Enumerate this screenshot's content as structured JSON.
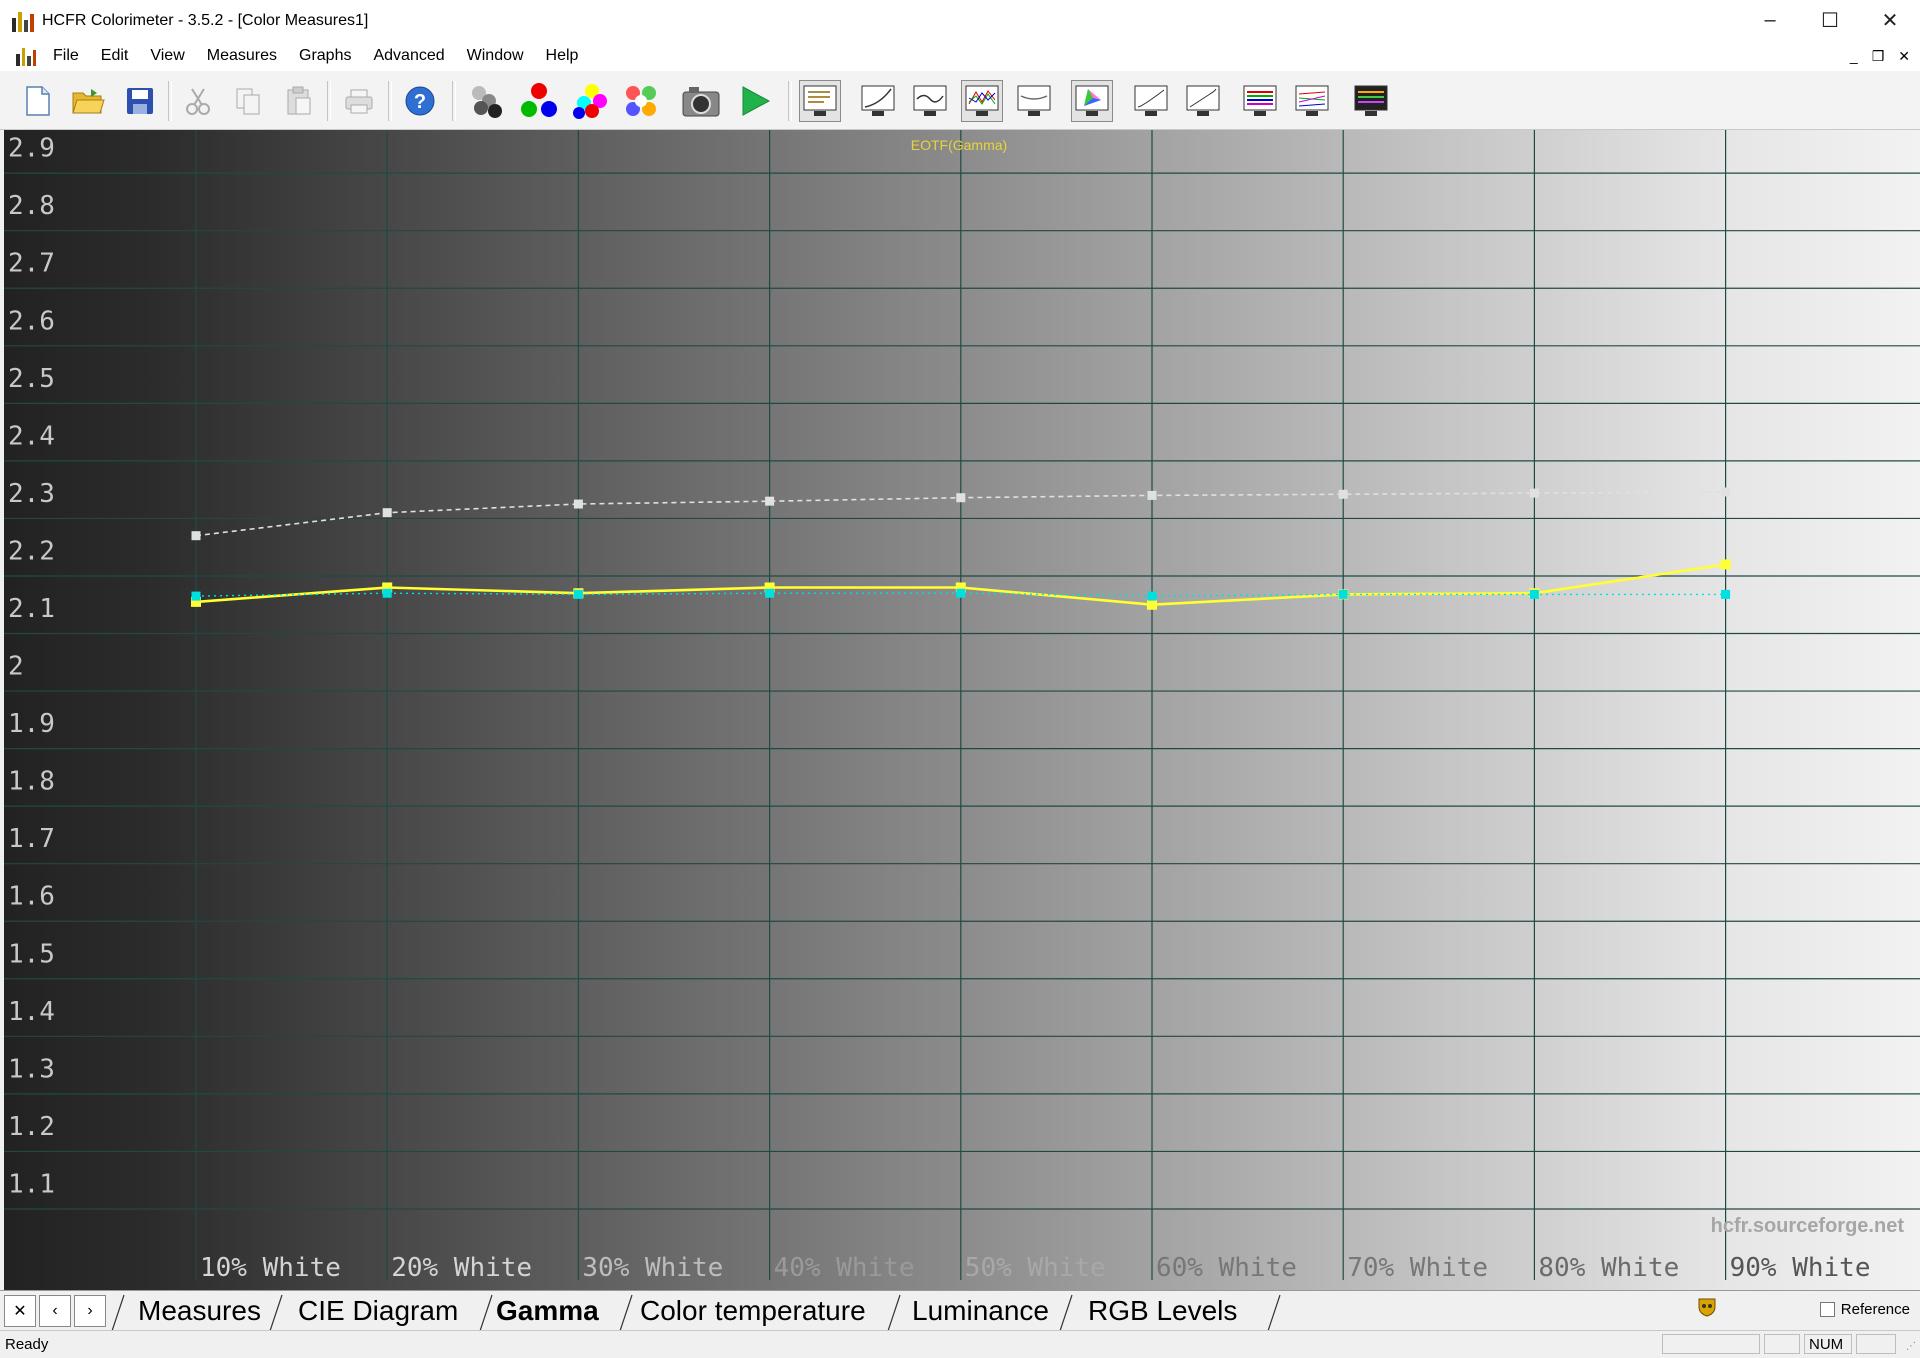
{
  "window": {
    "title": "HCFR Colorimeter - 3.5.2 - [Color Measures1]",
    "controls": [
      "–",
      "☐",
      "✕"
    ]
  },
  "menu": {
    "items": [
      "File",
      "Edit",
      "View",
      "Measures",
      "Graphs",
      "Advanced",
      "Window",
      "Help"
    ],
    "mdi_controls": [
      "_",
      "❒",
      "✕"
    ]
  },
  "toolbar": {
    "buttons": [
      "new-file-icon",
      "open-folder-icon",
      "save-icon",
      "cut-icon",
      "copy-icon",
      "paste-icon",
      "print-icon",
      "help-icon",
      "grayscale-measure-icon",
      "primaries-measure-icon",
      "secondaries-measure-icon",
      "saturation-measure-icon",
      "camera-icon",
      "play-icon",
      "measures-view-icon",
      "gamma-view-icon",
      "luminance-view-icon",
      "rgb-levels-view-icon",
      "color-temp-view-icon",
      "cie-view-icon",
      "near-black-view-icon",
      "near-white-view-icon",
      "saturation-view-icon",
      "saturation-shift-view-icon",
      "colorchecker-view-icon"
    ]
  },
  "chart_data": {
    "type": "line",
    "title": "EOTF(Gamma)",
    "watermark": "hcfr.sourceforge.net",
    "categories": [
      "10% White",
      "20% White",
      "30% White",
      "40% White",
      "50% White",
      "60% White",
      "70% White",
      "80% White",
      "90% White"
    ],
    "y_ticks": [
      "2.9",
      "2.8",
      "2.7",
      "2.6",
      "2.5",
      "2.4",
      "2.3",
      "2.2",
      "2.1",
      "2",
      "1.9",
      "1.8",
      "1.7",
      "1.6",
      "1.5",
      "1.4",
      "1.3",
      "1.2",
      "1.1"
    ],
    "ylim": [
      1.02,
      2.975
    ],
    "grid": true,
    "series": [
      {
        "color": "#e0e0e0",
        "style": "dashed",
        "values": [
          2.27,
          2.31,
          2.325,
          2.33,
          2.336,
          2.34,
          2.342,
          2.344,
          2.346
        ]
      },
      {
        "color": "#ffff33",
        "style": "solid",
        "values": [
          2.155,
          2.18,
          2.17,
          2.18,
          2.18,
          2.15,
          2.168,
          2.17,
          2.22
        ]
      },
      {
        "color": "#00e0e0",
        "style": "dotted",
        "values": [
          2.165,
          2.17,
          2.168,
          2.17,
          2.17,
          2.165,
          2.168,
          2.168,
          2.168
        ]
      }
    ]
  },
  "tabs": {
    "nav": [
      "✕",
      "‹",
      "›"
    ],
    "items": [
      "Measures",
      "CIE Diagram",
      "Gamma",
      "Color temperature",
      "Luminance",
      "RGB Levels"
    ],
    "active": "Gamma",
    "reference_label": "Reference"
  },
  "status": {
    "text": "Ready",
    "num": "NUM"
  }
}
